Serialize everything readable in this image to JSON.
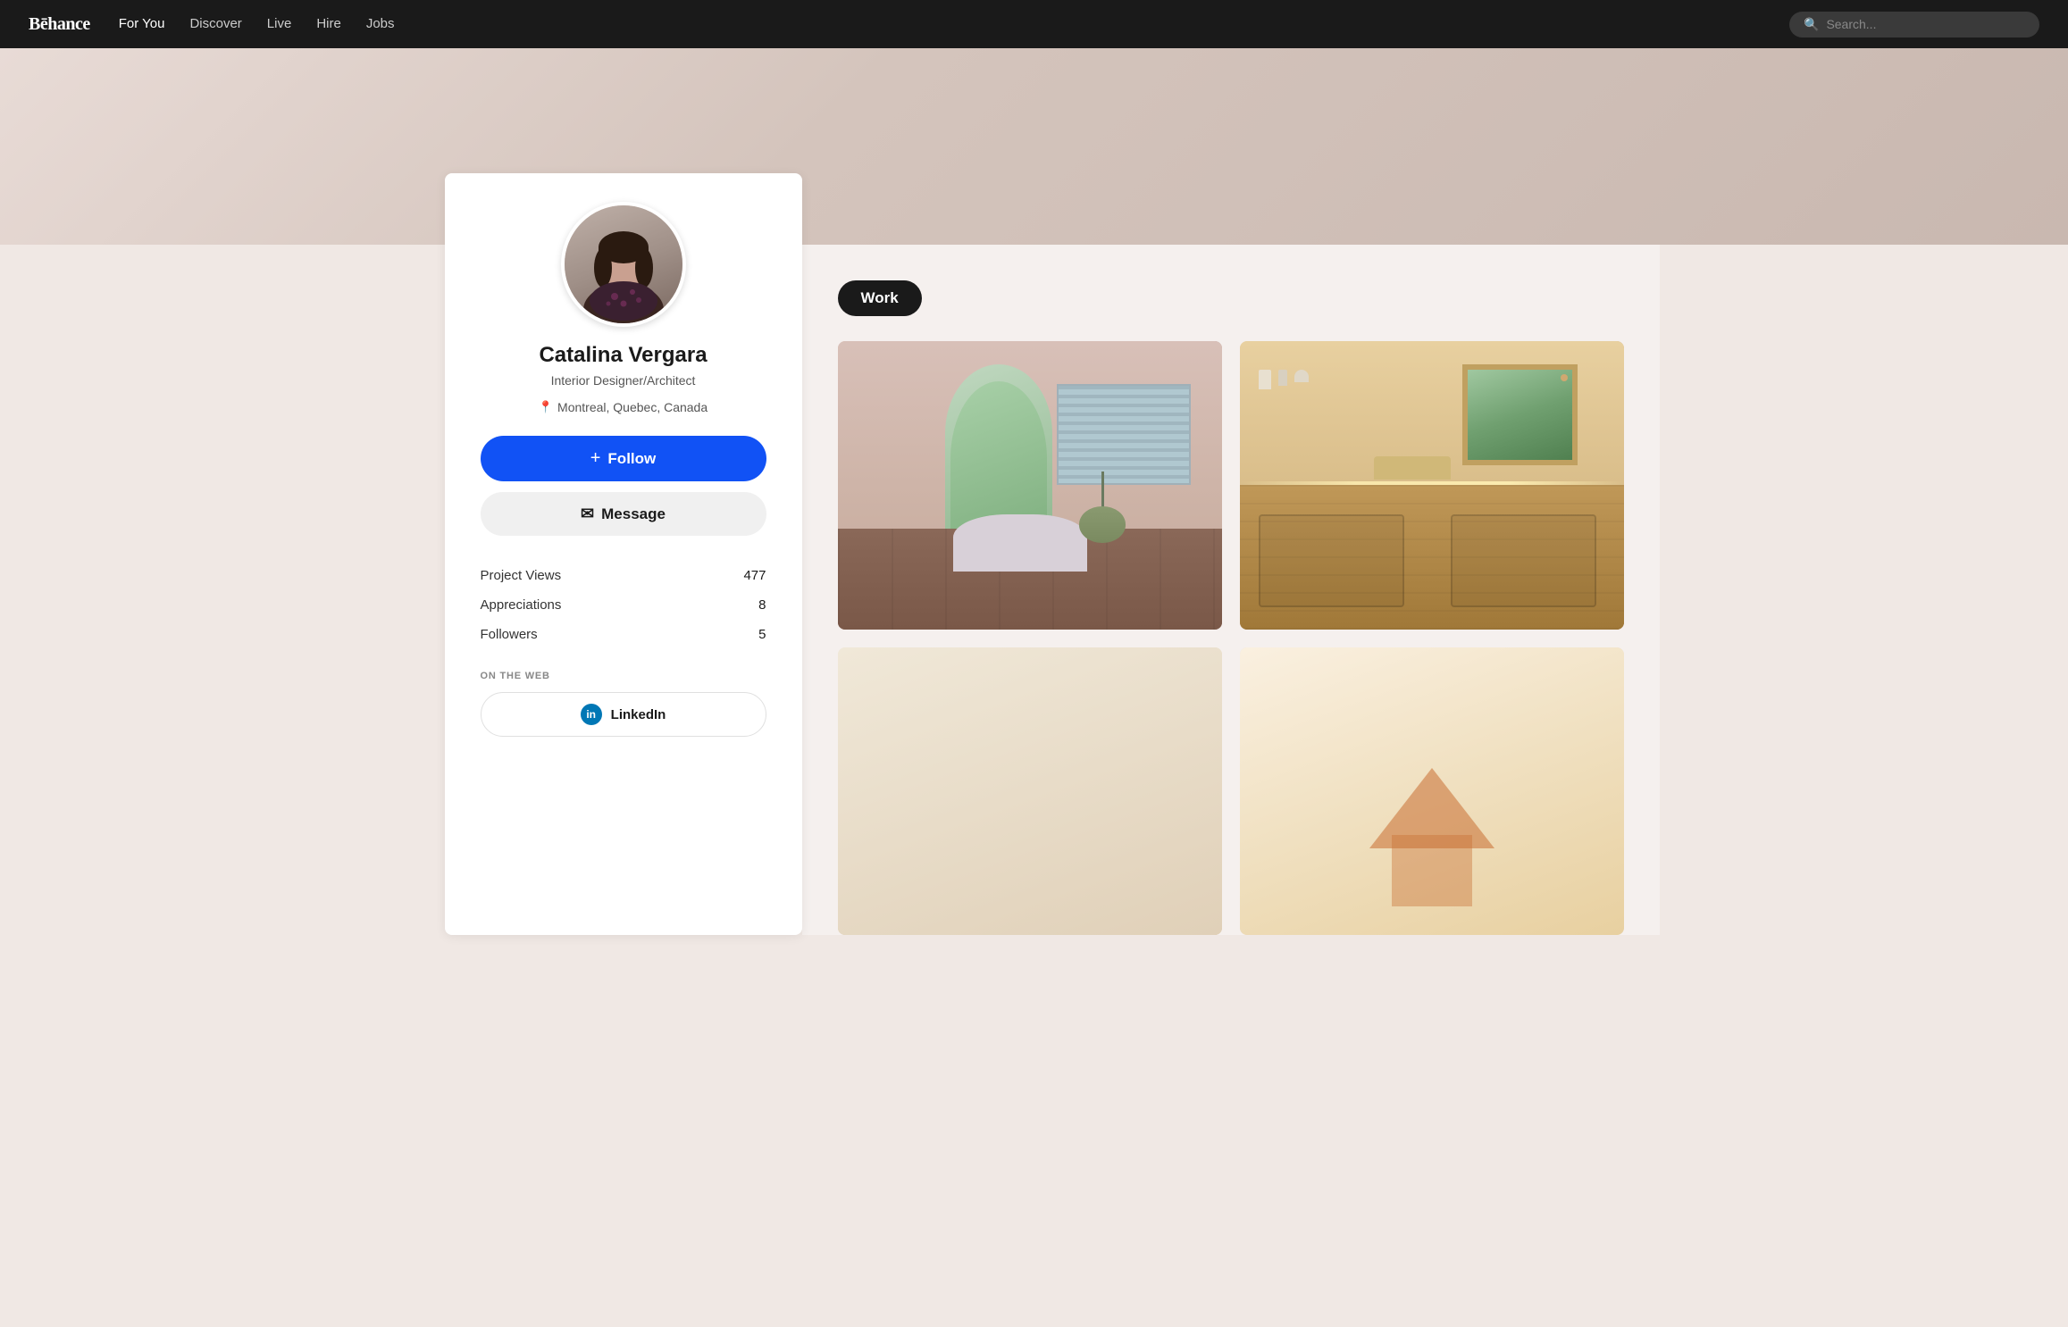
{
  "navbar": {
    "logo": "Bē​hance",
    "nav_items": [
      {
        "label": "For You",
        "active": true
      },
      {
        "label": "Discover",
        "active": false
      },
      {
        "label": "Live",
        "active": false
      },
      {
        "label": "Hire",
        "active": false
      },
      {
        "label": "Jobs",
        "active": false
      }
    ],
    "search_placeholder": "Search..."
  },
  "profile": {
    "name": "Catalina Vergara",
    "title": "Interior Designer/Architect",
    "location": "Montreal, Quebec, Canada",
    "follow_label": "Follow",
    "message_label": "Message",
    "stats": [
      {
        "label": "Project Views",
        "value": "477"
      },
      {
        "label": "Appreciations",
        "value": "8"
      },
      {
        "label": "Followers",
        "value": "5"
      }
    ],
    "on_web_label": "ON THE WEB",
    "linkedin_label": "LinkedIn"
  },
  "work_section": {
    "tab_label": "Work",
    "projects": [
      {
        "id": 1,
        "style": "bathroom-1"
      },
      {
        "id": 2,
        "style": "bathroom-2"
      },
      {
        "id": 3,
        "style": "card-3"
      },
      {
        "id": 4,
        "style": "card-4"
      }
    ]
  }
}
